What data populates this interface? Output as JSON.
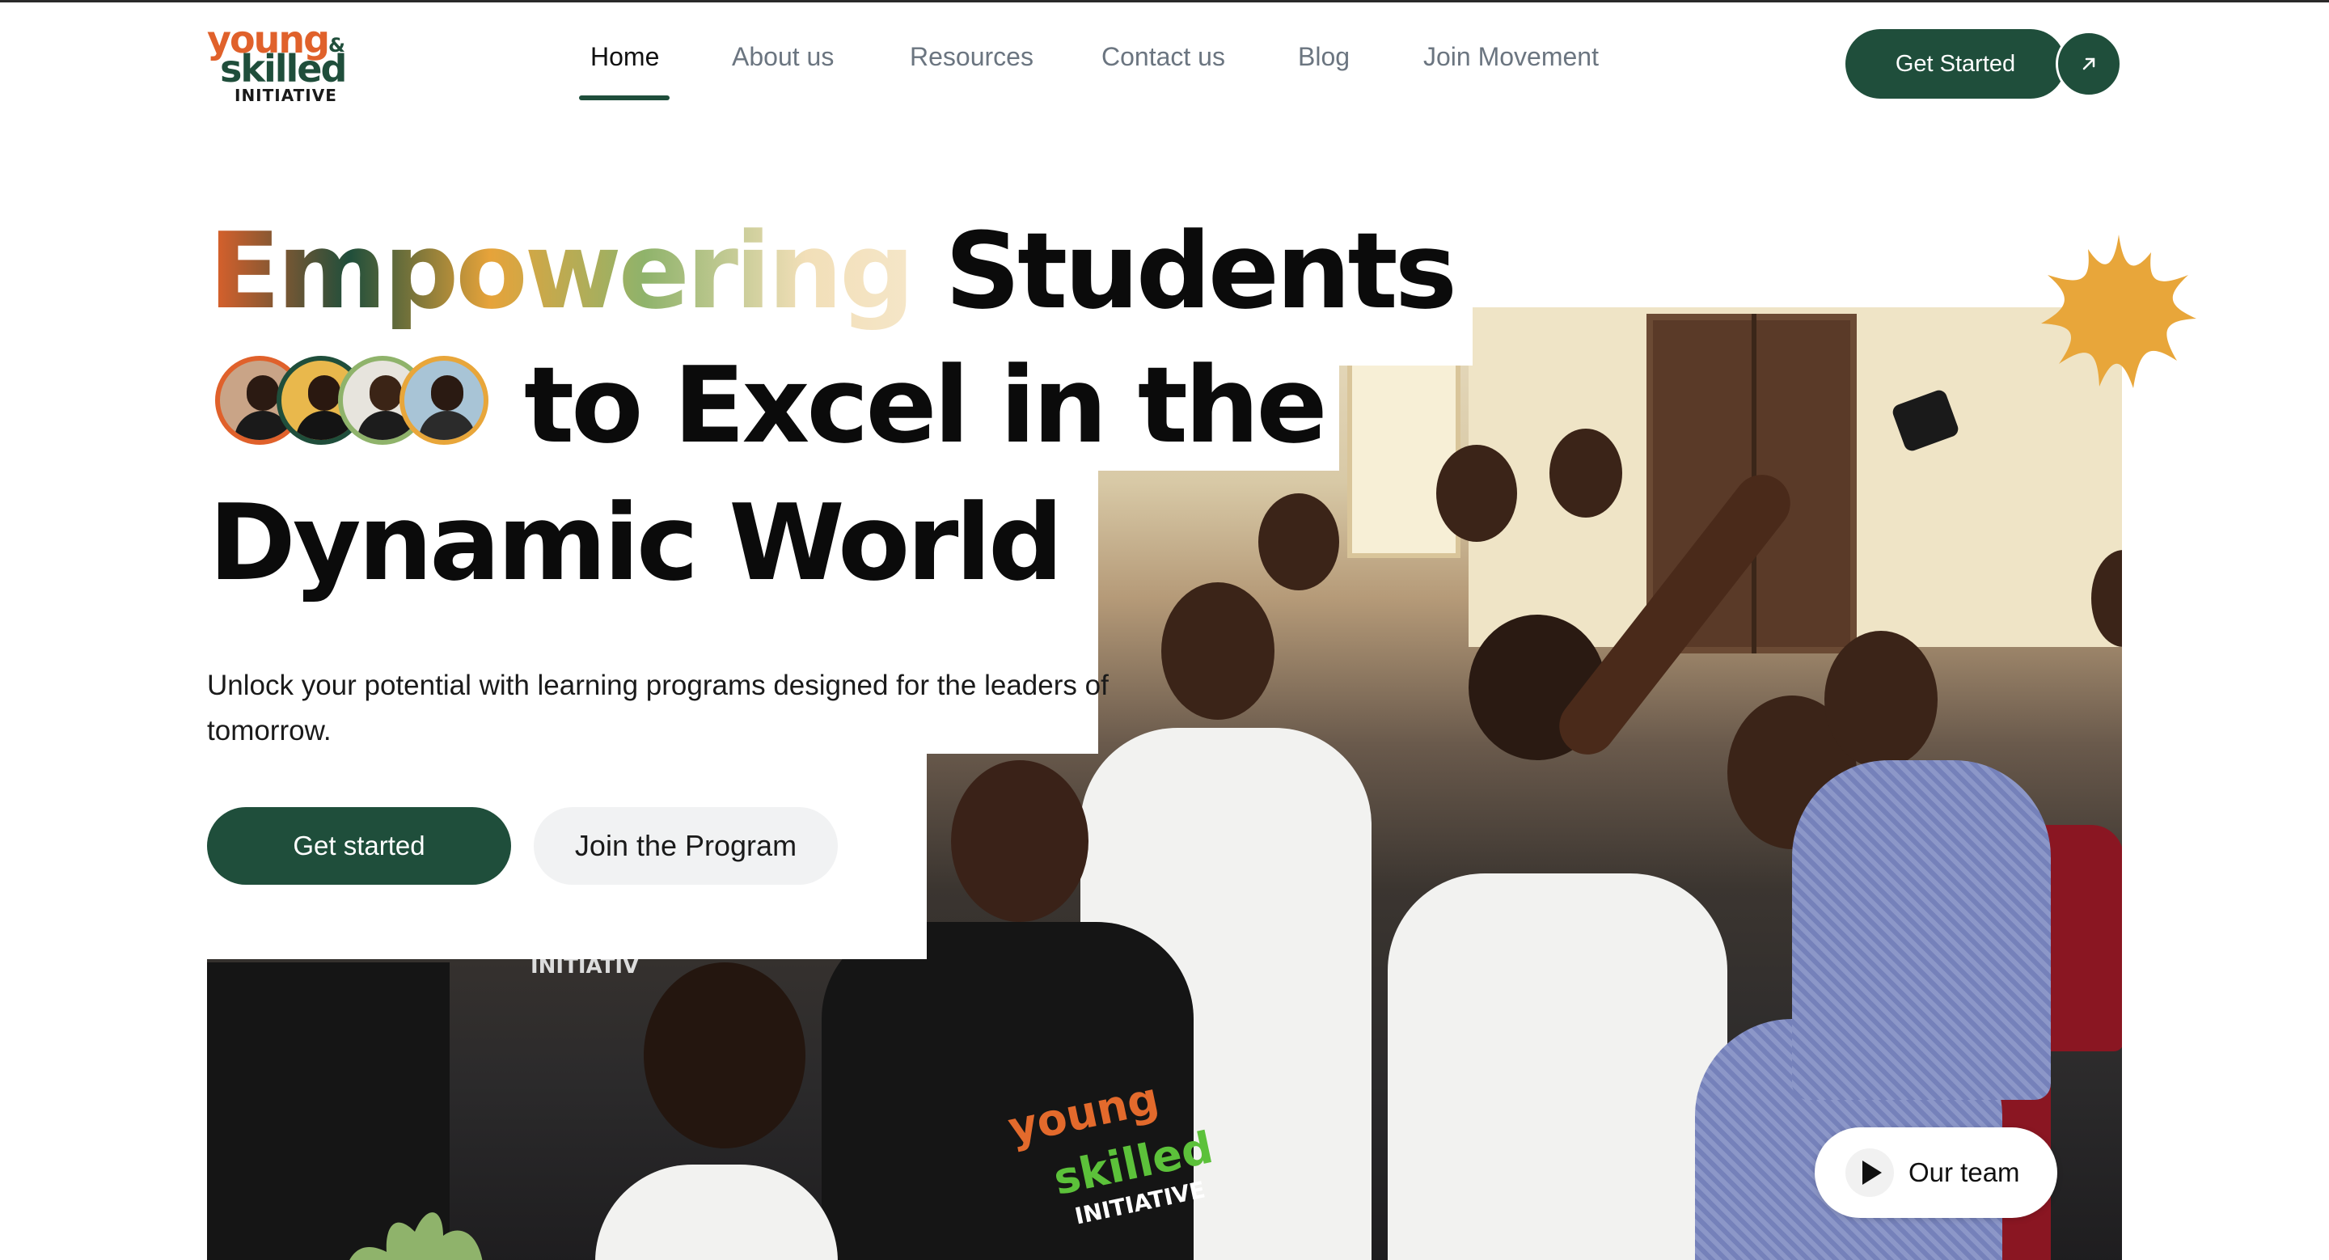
{
  "header": {
    "logo": {
      "line1": "young",
      "line2": "skilled",
      "amp": "&",
      "line3": "INITIATIVE"
    },
    "nav": [
      {
        "label": "Home",
        "active": true
      },
      {
        "label": "About us",
        "active": false
      },
      {
        "label": "Resources",
        "active": false
      },
      {
        "label": "Contact us",
        "active": false
      },
      {
        "label": "Blog",
        "active": false
      },
      {
        "label": "Join Movement",
        "active": false
      }
    ],
    "cta_label": "Get Started",
    "cta_icon": "arrow-up-right-icon"
  },
  "hero": {
    "headline_highlight": "Empowering",
    "headline_line1_rest": "Students",
    "headline_line2": "to Excel in the",
    "headline_line3": "Dynamic World",
    "subtitle": "Unlock your potential with learning programs designed for the leaders of tomorrow.",
    "primary_button": "Get started",
    "secondary_button": "Join the Program",
    "team_button": "Our team",
    "team_icon": "play-icon",
    "photo_shirt_text": {
      "line1": "young",
      "line2": "skilled",
      "line3": "INITIATIVE"
    },
    "photo_banner_text": "INITIATIV"
  },
  "colors": {
    "brand_green": "#1f4e3b",
    "brand_orange": "#e0612b",
    "accent_yellow": "#e8a63a",
    "accent_green_light": "#8fb36b"
  }
}
